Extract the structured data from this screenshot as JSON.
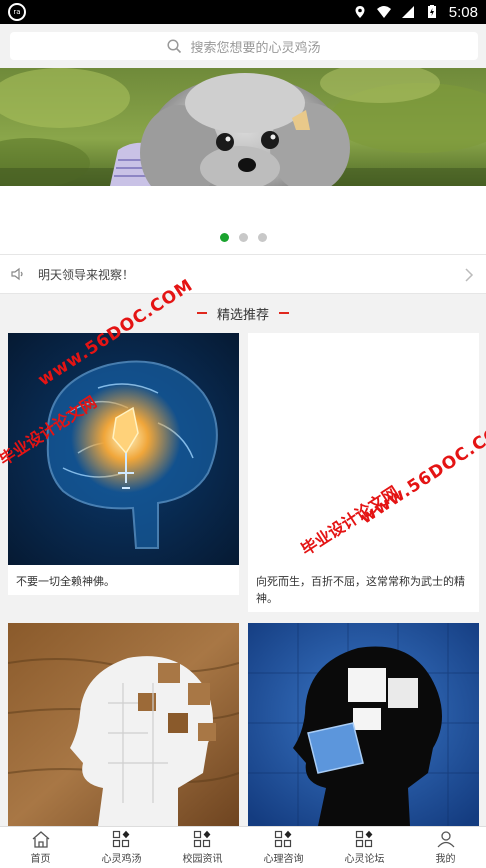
{
  "status_bar": {
    "time": "5:08",
    "left_icon": "notification-icon",
    "icons": [
      "location-icon",
      "wifi-icon",
      "signal-icon",
      "battery-icon"
    ]
  },
  "search": {
    "placeholder": "搜索您想要的心灵鸡汤",
    "icon": "search-icon"
  },
  "banner": {
    "slide_count": 3,
    "active_index": 0
  },
  "notice": {
    "text": "明天领导来视察！",
    "icon": "speaker-icon"
  },
  "section": {
    "title": "精选推荐",
    "accent_color": "#e0281e"
  },
  "cards": [
    {
      "caption": "不要一切全赖神佛。"
    },
    {
      "caption": "向死而生，百折不屈，这常常称为武士的精神。"
    },
    {
      "caption": ""
    },
    {
      "caption": ""
    }
  ],
  "tab_bar": {
    "items": [
      {
        "label": "首页",
        "icon": "home-icon"
      },
      {
        "label": "心灵鸡汤",
        "icon": "grid-icon"
      },
      {
        "label": "校园资讯",
        "icon": "grid-icon"
      },
      {
        "label": "心理咨询",
        "icon": "grid-icon"
      },
      {
        "label": "心灵论坛",
        "icon": "grid-icon"
      },
      {
        "label": "我的",
        "icon": "user-icon"
      }
    ]
  },
  "watermarks": {
    "site_1": "www.56DOC.COM",
    "site_2": "www.56DOC.COM",
    "title_1": "毕业设计论文网",
    "title_2": "毕业设计论文网"
  },
  "colors": {
    "active_dot": "#1aa32e",
    "watermark": "#e41414"
  }
}
